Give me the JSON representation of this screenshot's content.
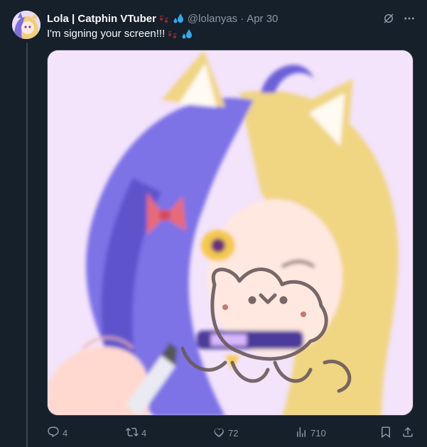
{
  "tweet": {
    "author_name": "Lola | Catphin VTuber",
    "author_emoji": [
      "paw-prints-emoji",
      "sweat-droplets-emoji"
    ],
    "handle": "@lolanyas",
    "separator": "·",
    "date": "Apr 30",
    "text": "I'm signing your screen!!!",
    "text_emoji": [
      "paw-prints-emoji",
      "sweat-droplets-emoji"
    ],
    "media_description_icon": "anime-catgirl-artwork",
    "signature_text": "Lola"
  },
  "actions": {
    "replies": "4",
    "reposts": "4",
    "likes": "72",
    "views": "710"
  },
  "icons": {
    "reply": "reply-icon",
    "repost": "repost-icon",
    "like": "like-icon",
    "views": "views-icon",
    "bookmark": "bookmark-icon",
    "share": "share-icon",
    "grok": "grok-icon",
    "more": "more-icon"
  },
  "colors": {
    "background": "#15202b",
    "text_primary": "#f7f9f9",
    "text_secondary": "#8b98a5",
    "paw_color": "#8b2a2e",
    "droplet_color": "#3aa6e8"
  }
}
